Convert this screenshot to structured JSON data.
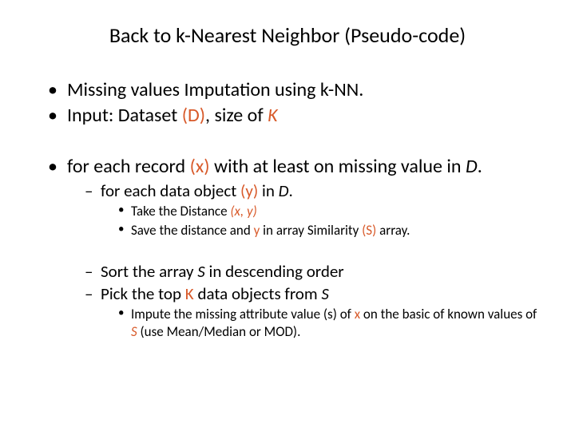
{
  "title": "Back to k-Nearest Neighbor (Pseudo-code)",
  "b1": {
    "t1": "Missing values Imputation using k-NN.",
    "t2a": "Input: Dataset ",
    "t2b": "(D)",
    "t2c": ", size of ",
    "t2d": "K",
    "t3a": "for each record ",
    "t3b": "(x)",
    "t3c": " with at least on missing value in ",
    "t3d": "D",
    "t3e": "."
  },
  "b2": {
    "t1a": "for each data object ",
    "t1b": "(y)",
    "t1c": " in ",
    "t1d": "D",
    "t1e": ".",
    "t2a": "Sort the array ",
    "t2b": "S",
    "t2c": " in descending order",
    "t3a": "Pick the top ",
    "t3b": "K",
    "t3c": " data objects from ",
    "t3d": "S"
  },
  "b3": {
    "t1a": "Take the Distance ",
    "t1b": "(x, y)",
    "t2a": "Save the distance and ",
    "t2b": "y",
    "t2c": " in array Similarity ",
    "t2d": "(S)",
    "t2e": " array.",
    "t3a": "Impute the missing attribute value (s) of ",
    "t3b": "x",
    "t3c": " on the basic of known values of ",
    "t3d": "S",
    "t3e": " (use Mean/Median or MOD)."
  }
}
